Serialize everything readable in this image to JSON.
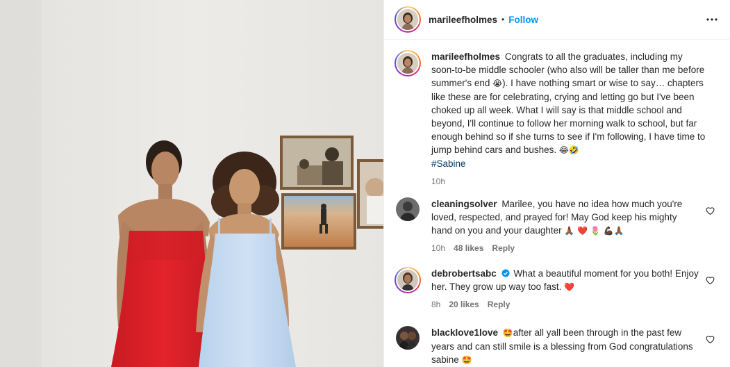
{
  "post": {
    "author": "marileefholmes",
    "dot": "•",
    "follow_label": "Follow",
    "more_icon": "more-horizontal-icon"
  },
  "caption": {
    "username": "marileefholmes",
    "text_1": "Congrats to all the graduates, including my soon-to-be middle schooler (who also will be taller than me before summer's end ",
    "emoji_1": "😭",
    "text_2": "). I have nothing smart or wise to say… chapters like these are for celebrating, crying and letting go but I've been choked up all week. What I will say is that middle school and beyond, I'll continue to follow her morning walk to school, but far enough behind so if she turns to see if I'm following, I have time to jump behind cars and bushes. ",
    "emoji_2": "😂🤣",
    "hashtag": "#Sabine",
    "time": "10h"
  },
  "comments": [
    {
      "username": "cleaningsolver",
      "text": "Marilee, you have no idea how much you're loved, respected, and prayed for! May God keep his mighty hand on you and your daughter ",
      "emoji": "🙏🏾 ❤️ 🌷 💪🏿🙏🏾",
      "time": "10h",
      "likes": "48 likes",
      "reply": "Reply"
    },
    {
      "username": "debrobertsabc",
      "verified": true,
      "text": "What a beautiful moment for you both! Enjoy her. They grow up way too fast. ",
      "emoji": "❤️",
      "time": "8h",
      "likes": "20 likes",
      "reply": "Reply"
    },
    {
      "username": "blacklove1love",
      "emoji_lead": "🤩",
      "text": "after all yall been through in the past few years and can still smile is a blessing from God congratulations sabine ",
      "emoji": "🤩"
    }
  ],
  "colors": {
    "accent": "#0095f6",
    "hashtag": "#00376b",
    "heart_red": "#ed4956",
    "verified": "#0095f6",
    "muted": "#737373"
  }
}
